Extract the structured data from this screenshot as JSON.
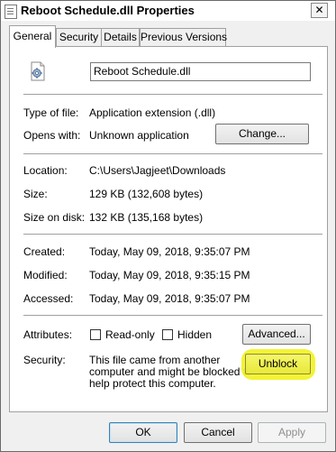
{
  "window": {
    "title": "Reboot Schedule.dll Properties",
    "close_glyph": "✕"
  },
  "tabs": [
    {
      "label": "General",
      "active": true
    },
    {
      "label": "Security",
      "active": false
    },
    {
      "label": "Details",
      "active": false
    },
    {
      "label": "Previous Versions",
      "active": false
    }
  ],
  "general": {
    "file_name": "Reboot Schedule.dll",
    "type_label": "Type of file:",
    "type_value": "Application extension (.dll)",
    "opens_label": "Opens with:",
    "opens_value": "Unknown application",
    "change_button": "Change...",
    "location_label": "Location:",
    "location_value": "C:\\Users\\Jagjeet\\Downloads",
    "size_label": "Size:",
    "size_value": "129 KB (132,608 bytes)",
    "size_disk_label": "Size on disk:",
    "size_disk_value": "132 KB (135,168 bytes)",
    "created_label": "Created:",
    "created_value": "Today, May 09, 2018, 9:35:07 PM",
    "modified_label": "Modified:",
    "modified_value": "Today, May 09, 2018, 9:35:15 PM",
    "accessed_label": "Accessed:",
    "accessed_value": "Today, May 09, 2018, 9:35:07 PM",
    "attributes_label": "Attributes:",
    "readonly_label": "Read-only",
    "readonly_checked": false,
    "hidden_label": "Hidden",
    "hidden_checked": false,
    "advanced_button": "Advanced...",
    "security_label": "Security:",
    "security_text_1": "This file came from another",
    "security_text_2": "computer and might be blocked to",
    "security_text_3": "help protect this computer.",
    "unblock_button": "Unblock",
    "highlight_color": "#f2f22a"
  },
  "footer": {
    "ok": "OK",
    "cancel": "Cancel",
    "apply": "Apply"
  },
  "icons": {
    "title": "document-icon",
    "file": "dll-gear-file-icon"
  }
}
